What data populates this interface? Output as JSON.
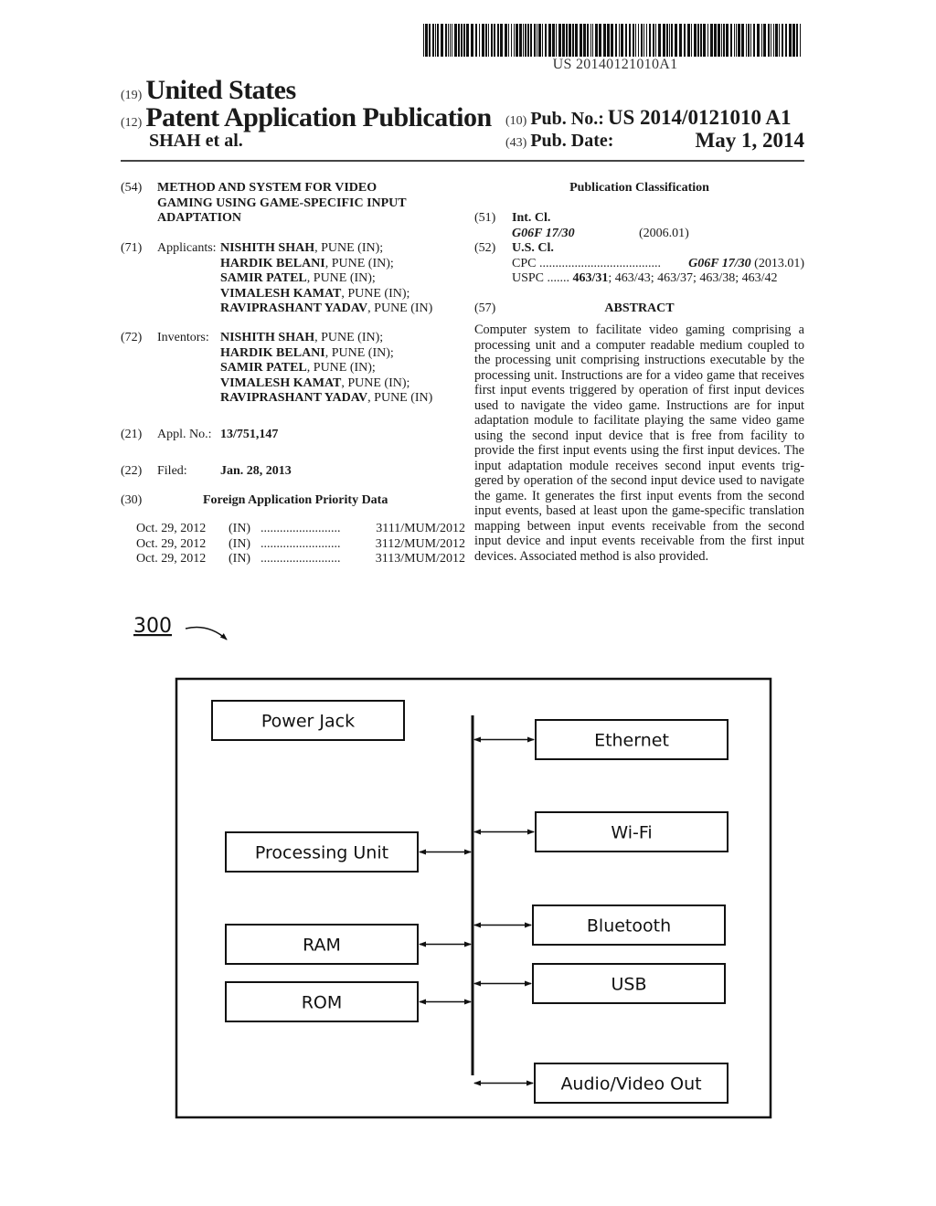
{
  "header": {
    "barcode_number": "US 20140121010A1",
    "code_19": "(19)",
    "country": "United States",
    "code_12": "(12)",
    "doc_type": "Patent Application Publication",
    "applicant_short": "SHAH et al.",
    "code_10": "(10)",
    "pub_no_label": "Pub. No.:",
    "pub_no": "US 2014/0121010 A1",
    "code_43": "(43)",
    "pub_date_label": "Pub. Date:",
    "pub_date": "May 1, 2014"
  },
  "left": {
    "title": {
      "code": "(54)",
      "lines": [
        "METHOD AND SYSTEM FOR VIDEO",
        "GAMING USING GAME-SPECIFIC INPUT",
        "ADAPTATION"
      ]
    },
    "applicants": {
      "code": "(71)",
      "label": "Applicants:",
      "people": [
        {
          "name": "NISHITH SHAH",
          "loc": ", PUNE (IN);"
        },
        {
          "name": "HARDIK BELANI",
          "loc": ", PUNE (IN);"
        },
        {
          "name": "SAMIR PATEL",
          "loc": ", PUNE (IN);"
        },
        {
          "name": "VIMALESH KAMAT",
          "loc": ", PUNE (IN);"
        },
        {
          "name": "RAVIPRASHANT YADAV",
          "loc": ", PUNE (IN)"
        }
      ]
    },
    "inventors": {
      "code": "(72)",
      "label": "Inventors:",
      "people": [
        {
          "name": "NISHITH SHAH",
          "loc": ", PUNE (IN);"
        },
        {
          "name": "HARDIK BELANI",
          "loc": ", PUNE (IN);"
        },
        {
          "name": "SAMIR PATEL",
          "loc": ", PUNE (IN);"
        },
        {
          "name": "VIMALESH KAMAT",
          "loc": ", PUNE (IN);"
        },
        {
          "name": "RAVIPRASHANT YADAV",
          "loc": ", PUNE (IN)"
        }
      ]
    },
    "appl_no": {
      "code": "(21)",
      "label": "Appl. No.:",
      "value": "13/751,147"
    },
    "filed": {
      "code": "(22)",
      "label": "Filed:",
      "value": "Jan. 28, 2013"
    },
    "priority": {
      "code": "(30)",
      "heading": "Foreign Application Priority Data",
      "rows": [
        {
          "date": "Oct. 29, 2012",
          "country": "(IN)",
          "dots": ".........................",
          "number": "3111/MUM/2012"
        },
        {
          "date": "Oct. 29, 2012",
          "country": "(IN)",
          "dots": ".........................",
          "number": "3112/MUM/2012"
        },
        {
          "date": "Oct. 29, 2012",
          "country": "(IN)",
          "dots": ".........................",
          "number": "3113/MUM/2012"
        }
      ]
    }
  },
  "right": {
    "classification_heading": "Publication Classification",
    "int_cl": {
      "code": "(51)",
      "label": "Int. Cl.",
      "class": "G06F 17/30",
      "version": "(2006.01)"
    },
    "us_cl": {
      "code": "(52)",
      "label": "U.S. Cl.",
      "cpc_label": "CPC",
      "cpc_dots": "......................................",
      "cpc_class": "G06F 17/30",
      "cpc_version": "(2013.01)",
      "uspc_label": "USPC",
      "uspc_dots": ".......",
      "uspc_main": "463/31",
      "uspc_rest": "; 463/43; 463/37; 463/38; 463/42"
    },
    "abstract": {
      "code": "(57)",
      "heading": "ABSTRACT",
      "text": "Computer system to facilitate video gaming comprising a processing unit and a computer readable medium coupled to the processing unit comprising instructions executable by the processing unit. Instructions are for a video game that receives first input events triggered by operation of first input devices used to navigate the video game. Instructions are for input adaptation module to facilitate playing the same video game using the second input device that is free from facility to provide the first input events using the first input devices. The input adaptation module receives second input events trig-gered by operation of the second input device used to navigate the game. It generates the first input events from the second input events, based at least upon the game-specific translation mapping between input events receivable from the second input device and input events receivable from the first input devices. Associated method is also provided."
    }
  },
  "figure": {
    "reference_label": "300",
    "left_blocks": [
      {
        "id": "power-jack",
        "label": "Power Jack",
        "connected": false
      },
      {
        "id": "processing-unit",
        "label": "Processing Unit",
        "connected": true
      },
      {
        "id": "ram",
        "label": "RAM",
        "connected": true
      },
      {
        "id": "rom",
        "label": "ROM",
        "connected": true
      }
    ],
    "right_blocks": [
      {
        "id": "ethernet",
        "label": "Ethernet",
        "connected": true
      },
      {
        "id": "wi-fi",
        "label": "Wi-Fi",
        "connected": true
      },
      {
        "id": "bluetooth",
        "label": "Bluetooth",
        "connected": true
      },
      {
        "id": "usb",
        "label": "USB",
        "connected": true
      },
      {
        "id": "audio-video-out",
        "label": "Audio/Video Out",
        "connected": true
      }
    ]
  }
}
